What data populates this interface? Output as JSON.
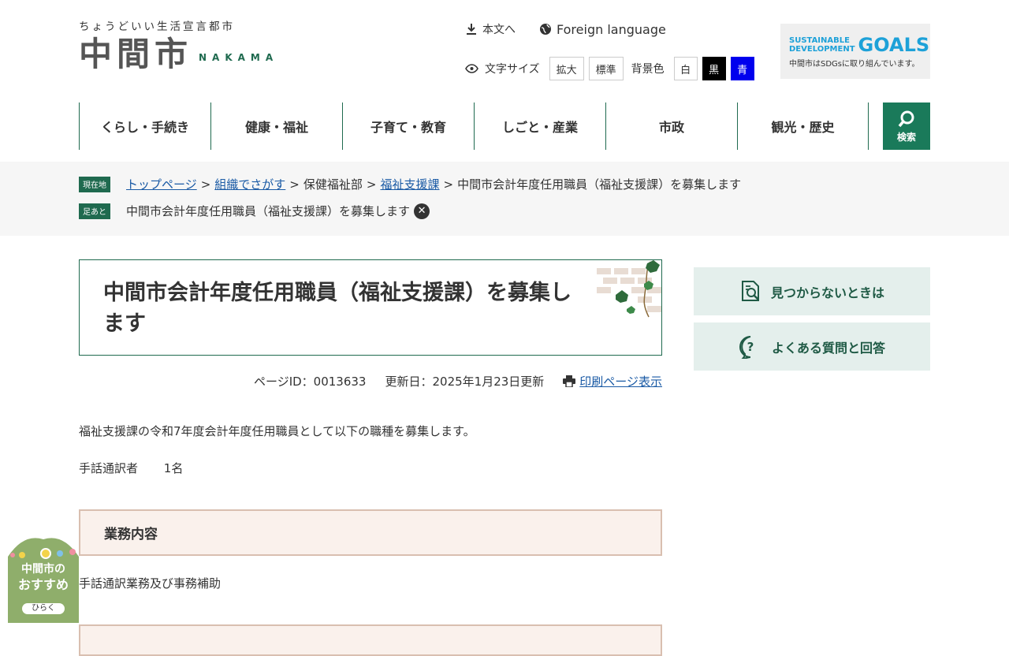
{
  "header": {
    "tagline": "ちょうどいい生活宣言都市",
    "logo_main": "中間市",
    "logo_roman": "NAKAMA",
    "skip_link": "本文へ",
    "foreign_language": "Foreign language",
    "font_size_label": "文字サイズ",
    "font_size_enlarge": "拡大",
    "font_size_standard": "標準",
    "bg_color_label": "背景色",
    "bg_white": "白",
    "bg_black": "黒",
    "bg_blue": "青",
    "sdgs_line1a": "SUSTAINABLE",
    "sdgs_line1b": "DEVELOPMENT",
    "sdgs_goals": "GOALS",
    "sdgs_sub": "中間市はSDGsに取り組んでいます。"
  },
  "nav": {
    "items": [
      "くらし・手続き",
      "健康・福祉",
      "子育て・教育",
      "しごと・産業",
      "市政",
      "観光・歴史"
    ],
    "search_label": "検索"
  },
  "breadcrumb": {
    "current_tag": "現在地",
    "links": [
      "トップページ",
      "組織でさがす"
    ],
    "plain": "保健福祉部",
    "link3": "福祉支援課",
    "current": "中間市会計年度任用職員（福祉支援課）を募集します",
    "history_tag": "足あと",
    "history_item": "中間市会計年度任用職員（福祉支援課）を募集します"
  },
  "page": {
    "title": "中間市会計年度任用職員（福祉支援課）を募集します",
    "page_id": "ページID：0013633",
    "updated": "更新日：2025年1月23日更新",
    "print_link": "印刷ページ表示",
    "intro": "福祉支援課の令和7年度会計年度任用職員として以下の職種を募集します。",
    "position": "手話通訳者",
    "count": "1名",
    "section1_title": "業務内容",
    "section1_body": "手話通訳業務及び事務補助"
  },
  "sidebar": {
    "not_found": "見つからないときは",
    "faq": "よくある質問と回答"
  },
  "recommend": {
    "line1": "中間市の",
    "line2": "おすすめ",
    "open": "ひらく"
  },
  "colors": {
    "primary_green": "#1f6a4f",
    "link_blue": "#1a5aa5",
    "sidebar_bg": "#e4efec",
    "section_bg": "#faf1ec"
  }
}
